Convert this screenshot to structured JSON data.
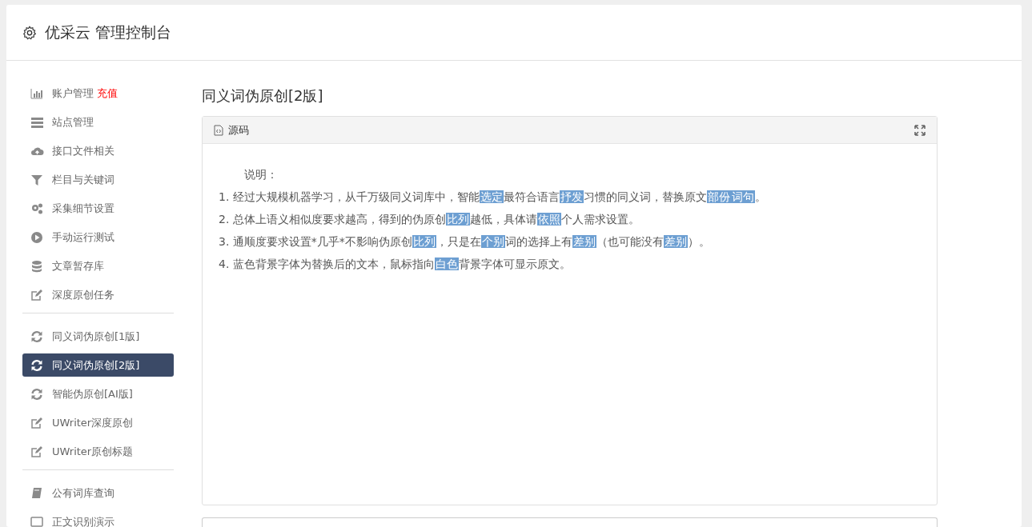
{
  "header": {
    "title": "优采云 管理控制台"
  },
  "sidebar": {
    "groups": [
      {
        "items": [
          {
            "kind": "chart",
            "label": "账户管理",
            "badge": "充值",
            "selected": false
          },
          {
            "kind": "server",
            "label": "站点管理",
            "selected": false
          },
          {
            "kind": "cloud",
            "label": "接口文件相关",
            "selected": false
          },
          {
            "kind": "filter",
            "label": "栏目与关键词",
            "selected": false
          },
          {
            "kind": "gears",
            "label": "采集细节设置",
            "selected": false
          },
          {
            "kind": "play",
            "label": "手动运行测试",
            "selected": false
          },
          {
            "kind": "database",
            "label": "文章暂存库",
            "selected": false
          },
          {
            "kind": "edit",
            "label": "深度原创任务",
            "selected": false
          }
        ]
      },
      {
        "items": [
          {
            "kind": "refresh",
            "label": "同义词伪原创[1版]",
            "selected": false
          },
          {
            "kind": "refresh",
            "label": "同义词伪原创[2版]",
            "selected": true
          },
          {
            "kind": "refresh",
            "label": "智能伪原创[AI版]",
            "selected": false
          },
          {
            "kind": "edit",
            "label": "UWriter深度原创",
            "selected": false
          },
          {
            "kind": "edit",
            "label": "UWriter原创标题",
            "selected": false
          }
        ]
      },
      {
        "items": [
          {
            "kind": "book",
            "label": "公有词库查询",
            "selected": false
          },
          {
            "kind": "window",
            "label": "正文识别演示",
            "selected": false
          }
        ]
      }
    ]
  },
  "main": {
    "title": "同义词伪原创[2版]",
    "panel": {
      "title": "源码",
      "heading": "说明：",
      "lines": [
        [
          {
            "text": "1. 经过大规模机器学习，从千万级同义词库中，智能",
            "replaced": false
          },
          {
            "text": "选定",
            "replaced": true
          },
          {
            "text": "最符合语言",
            "replaced": false
          },
          {
            "text": "抒发",
            "replaced": true
          },
          {
            "text": "习惯的同义词，替换原文",
            "replaced": false
          },
          {
            "text": "部份",
            "replaced": true
          },
          {
            "text": "词句",
            "replaced": true
          },
          {
            "text": "。",
            "replaced": false
          }
        ],
        [
          {
            "text": "2. 总体上语义相似度要求越高，得到的伪原创",
            "replaced": false
          },
          {
            "text": "比列",
            "replaced": true
          },
          {
            "text": "越低，具体请",
            "replaced": false
          },
          {
            "text": "依照",
            "replaced": true
          },
          {
            "text": "个人需求设置。",
            "replaced": false
          }
        ],
        [
          {
            "text": "3. 通顺度要求设置*几乎*不影响伪原创",
            "replaced": false
          },
          {
            "text": "比列",
            "replaced": true
          },
          {
            "text": "，只是在",
            "replaced": false
          },
          {
            "text": "个别",
            "replaced": true
          },
          {
            "text": "词的选择上有",
            "replaced": false
          },
          {
            "text": "差别",
            "replaced": true
          },
          {
            "text": "（也可能没有",
            "replaced": false
          },
          {
            "text": "差别",
            "replaced": true
          },
          {
            "text": "）。",
            "replaced": false
          }
        ],
        [
          {
            "text": "4. 蓝色背景字体为替换后的文本，鼠标指向",
            "replaced": false
          },
          {
            "text": "白色",
            "replaced": true
          },
          {
            "text": "背景字体可显示原文。",
            "replaced": false
          }
        ]
      ]
    }
  }
}
